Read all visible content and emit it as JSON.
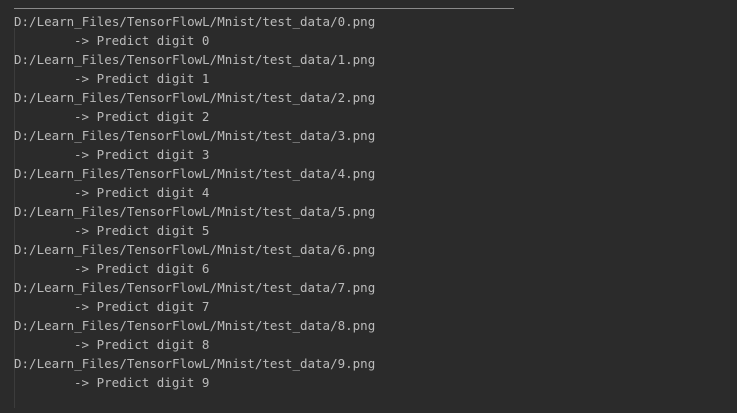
{
  "console": {
    "colors": {
      "background": "#2b2b2b",
      "text": "#bbbbbb"
    },
    "entries": [
      {
        "path": "D:/Learn_Files/TensorFlowL/Mnist/test_data/0.png",
        "result": "-> Predict digit 0"
      },
      {
        "path": "D:/Learn_Files/TensorFlowL/Mnist/test_data/1.png",
        "result": "-> Predict digit 1"
      },
      {
        "path": "D:/Learn_Files/TensorFlowL/Mnist/test_data/2.png",
        "result": "-> Predict digit 2"
      },
      {
        "path": "D:/Learn_Files/TensorFlowL/Mnist/test_data/3.png",
        "result": "-> Predict digit 3"
      },
      {
        "path": "D:/Learn_Files/TensorFlowL/Mnist/test_data/4.png",
        "result": "-> Predict digit 4"
      },
      {
        "path": "D:/Learn_Files/TensorFlowL/Mnist/test_data/5.png",
        "result": "-> Predict digit 5"
      },
      {
        "path": "D:/Learn_Files/TensorFlowL/Mnist/test_data/6.png",
        "result": "-> Predict digit 6"
      },
      {
        "path": "D:/Learn_Files/TensorFlowL/Mnist/test_data/7.png",
        "result": "-> Predict digit 7"
      },
      {
        "path": "D:/Learn_Files/TensorFlowL/Mnist/test_data/8.png",
        "result": "-> Predict digit 8"
      },
      {
        "path": "D:/Learn_Files/TensorFlowL/Mnist/test_data/9.png",
        "result": "-> Predict digit 9"
      }
    ]
  }
}
